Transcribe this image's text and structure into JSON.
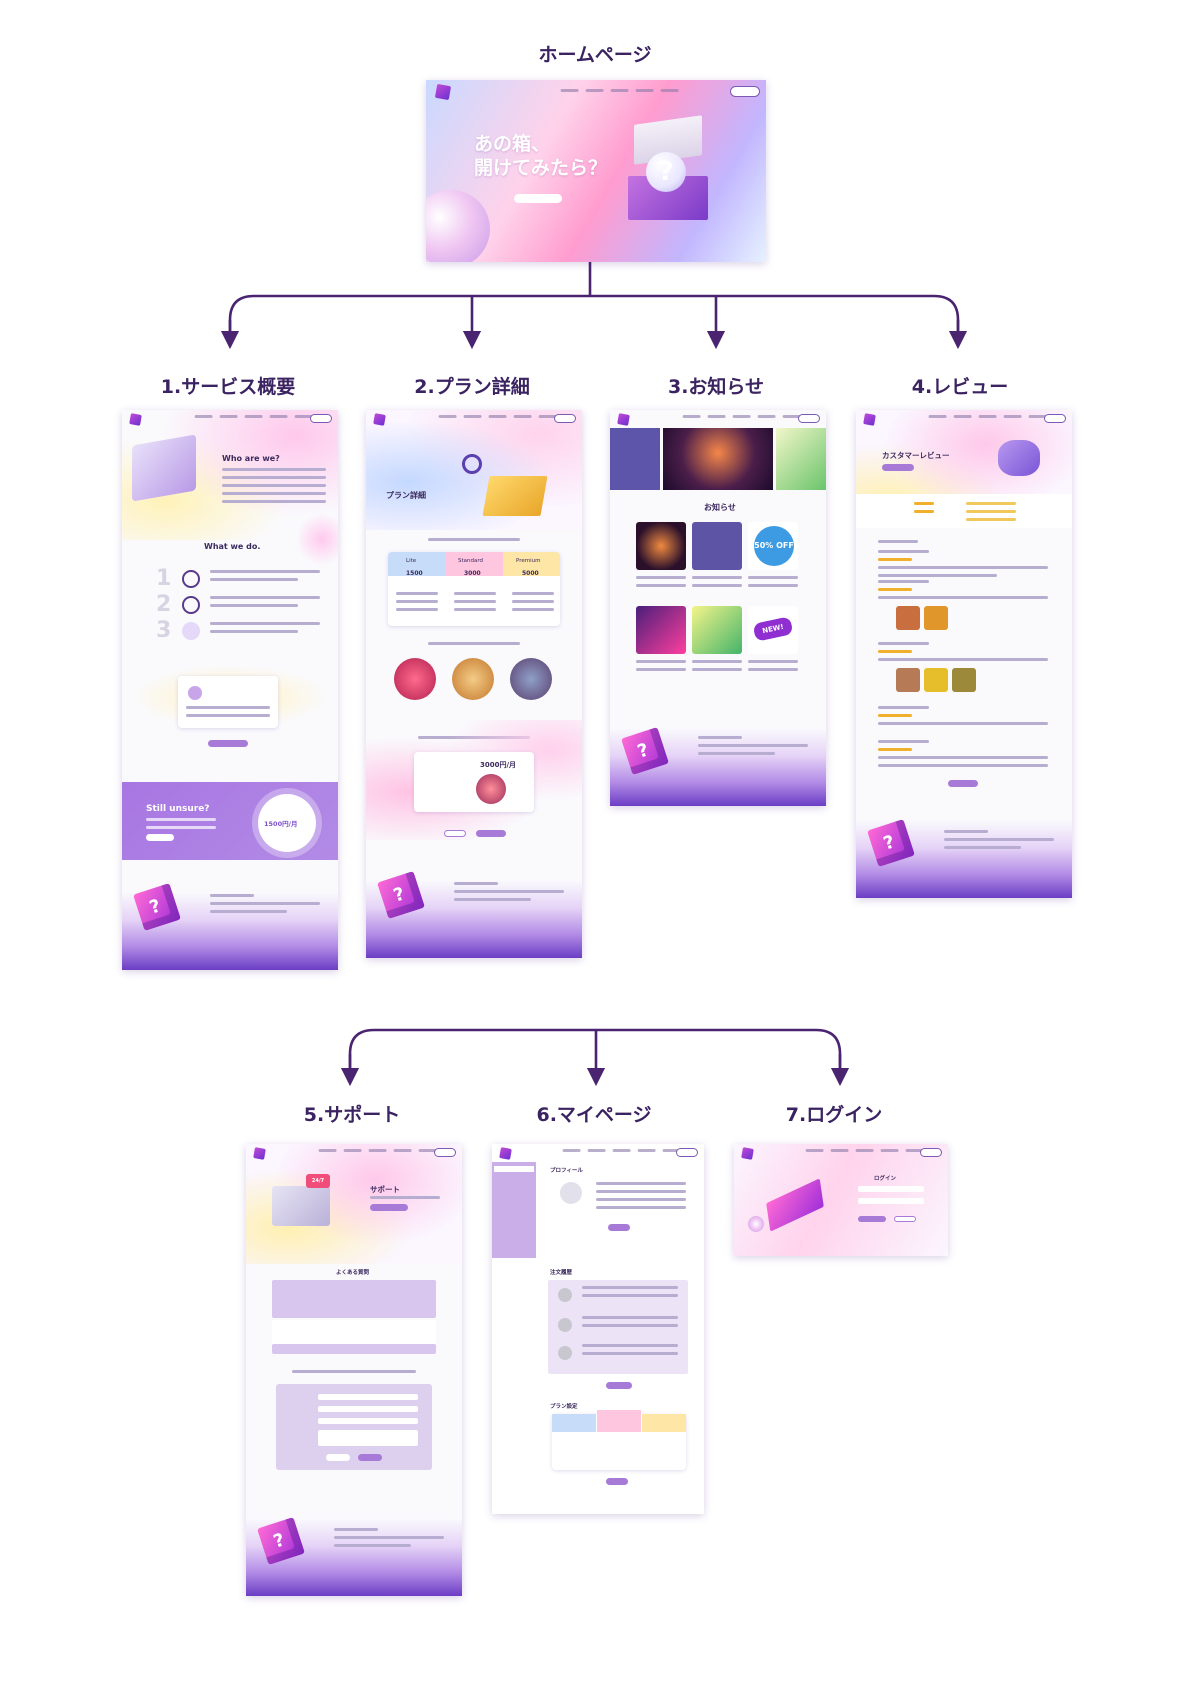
{
  "diagram": {
    "root": {
      "title": "ホームページ"
    },
    "level1": [
      {
        "title": "1.サービス概要"
      },
      {
        "title": "2.プラン詳細"
      },
      {
        "title": "3.お知らせ"
      },
      {
        "title": "4.レビュー"
      }
    ],
    "level2": [
      {
        "title": "5.サポート"
      },
      {
        "title": "6.マイページ"
      },
      {
        "title": "7.ログイン"
      }
    ]
  },
  "home": {
    "hero_line1": "あの箱、",
    "hero_line2": "開けてみたら？"
  },
  "service": {
    "heading1": "Who are we?",
    "heading2": "What we do.",
    "banner": "Still unsure?",
    "price": "1500円/月"
  },
  "plan": {
    "heading": "プラン詳細",
    "plans": [
      "Lite",
      "Standard",
      "Premium"
    ],
    "prices": [
      "1500",
      "3000",
      "5000"
    ],
    "selected_price": "3000円/月"
  },
  "news": {
    "heading": "お知らせ",
    "badge": "50% OFF",
    "new_badge": "NEW!"
  },
  "review": {
    "heading": "カスタマーレビュー"
  },
  "support": {
    "heading": "サポート",
    "faq": "よくある質問"
  },
  "mypage": {
    "profile": "プロフィール",
    "orders": "注文履歴",
    "plan": "プラン設定"
  },
  "login": {
    "heading": "ログイン"
  },
  "colors": {
    "accent": "#7a4fc9",
    "arrow": "#4a2470",
    "title": "#3a2360"
  }
}
